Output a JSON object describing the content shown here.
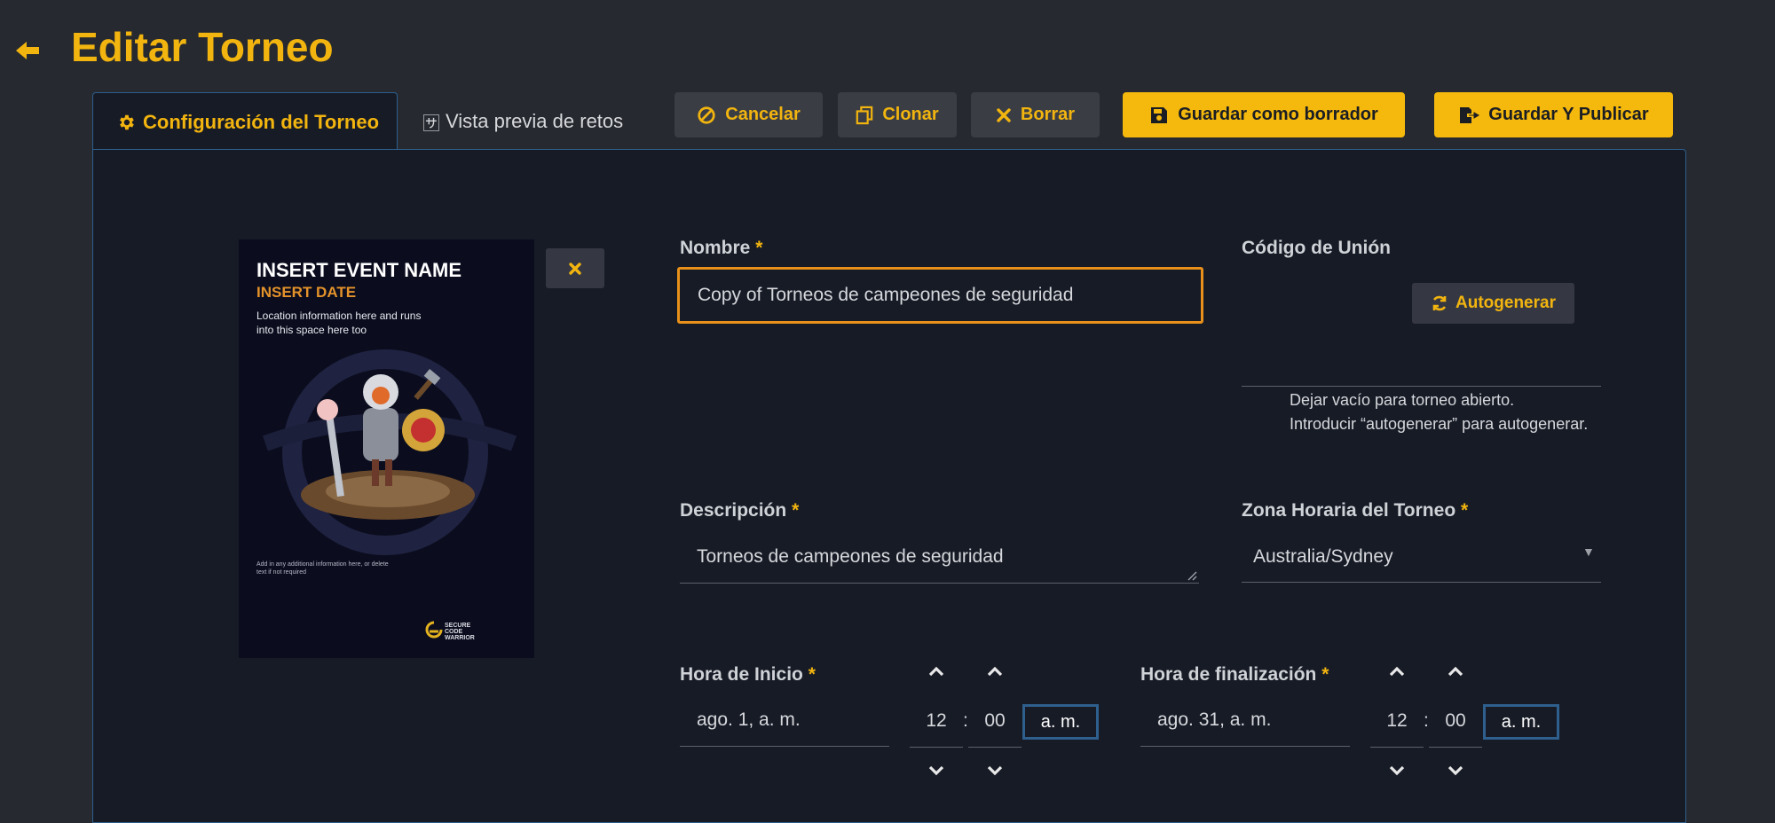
{
  "header": {
    "title": "Editar Torneo",
    "back_icon": "arrow-left-icon"
  },
  "tabs": [
    {
      "label": "Configuración del Torneo",
      "icon": "gear-icon",
      "active": true
    },
    {
      "label": "Vista previa de retos",
      "icon": "language-icon",
      "active": false
    }
  ],
  "toolbar": {
    "cancel_label": "Cancelar",
    "clone_label": "Clonar",
    "delete_label": "Borrar",
    "save_draft_label": "Guardar como borrador",
    "save_publish_label": "Guardar Y Publicar"
  },
  "poster": {
    "event_name": "INSERT EVENT NAME",
    "event_date": "INSERT DATE",
    "location": "Location information here and runs into this space here too",
    "footer": "Add in any additional information here, or delete text if not required",
    "brand_line1": "SECURE",
    "brand_line2": "CODE",
    "brand_line3": "WARRIOR"
  },
  "form": {
    "name": {
      "label": "Nombre",
      "required": "*",
      "value": "Copy of Torneos de campeones de seguridad"
    },
    "join_code": {
      "label": "Código de Unión",
      "autogen_label": "Autogenerar",
      "hint_line1": "Dejar vacío para torneo abierto.",
      "hint_line2": "Introducir “autogenerar” para autogenerar."
    },
    "description": {
      "label": "Descripción",
      "required": "*",
      "value": "Torneos de campeones de seguridad"
    },
    "timezone": {
      "label": "Zona Horaria del Torneo",
      "required": "*",
      "value": "Australia/Sydney"
    },
    "start": {
      "label": "Hora de Inicio",
      "required": "*",
      "date": "ago. 1, a. m.",
      "hour": "12",
      "separator": ":",
      "minute": "00",
      "ampm": "a. m."
    },
    "end": {
      "label": "Hora de finalización",
      "required": "*",
      "date": "ago. 31, a. m.",
      "hour": "12",
      "separator": ":",
      "minute": "00",
      "ampm": "a. m."
    }
  },
  "colors": {
    "accent": "#f5b90d",
    "panel": "#171b26",
    "background": "#26292f",
    "focus_border": "#e8901a",
    "tab_border": "#2e5f8d"
  }
}
